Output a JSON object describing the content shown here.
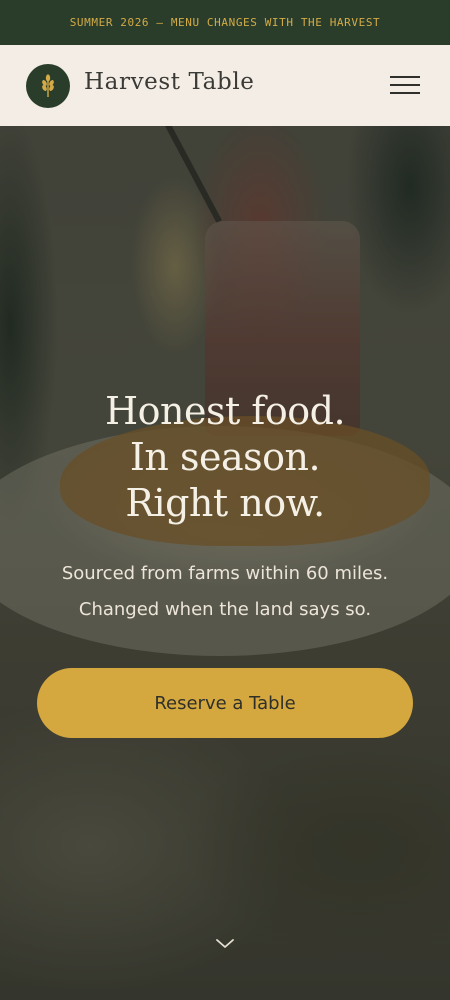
{
  "announcement": {
    "text": "SUMMER 2026 — MENU CHANGES WITH THE HARVEST"
  },
  "header": {
    "brand": "Harvest Table",
    "logo_icon": "wheat-icon",
    "menu_icon": "hamburger-menu-icon"
  },
  "hero": {
    "headline": [
      "Honest food.",
      "In season.",
      "Right now."
    ],
    "subtext": [
      "Sourced from farms within 60 miles.",
      "Changed when the land says so."
    ],
    "cta_label": "Reserve a Table",
    "scroll_icon": "chevron-down-icon"
  },
  "colors": {
    "brand_green": "#2a3d2b",
    "accent_gold": "#d4a83f",
    "header_bg": "#f3ede5"
  }
}
